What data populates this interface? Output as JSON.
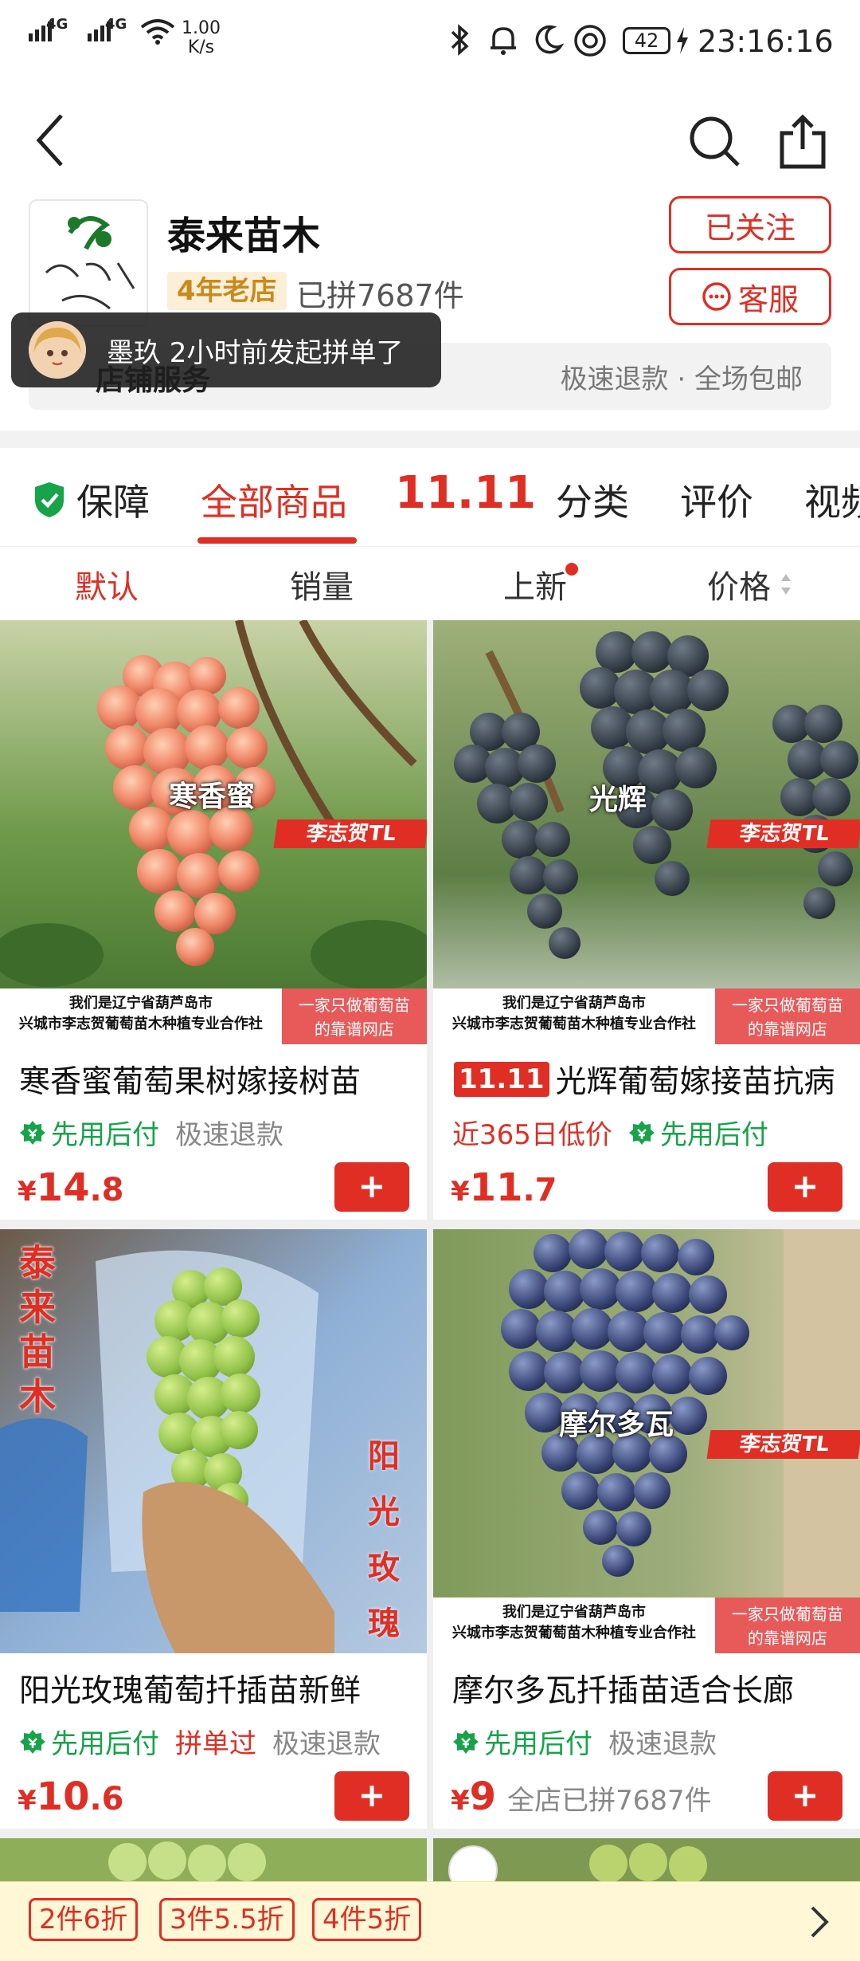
{
  "status_bar": {
    "network1": "4G",
    "network2": "4G",
    "speed_value": "1.00",
    "speed_unit": "K/s",
    "battery": "42",
    "time": "23:16:16"
  },
  "shop": {
    "name": "泰来苗木",
    "badge": "4年老店",
    "sold": "已拼7687件",
    "follow_label": "已关注",
    "service_label": "客服",
    "service_section_label": "店铺服务",
    "service_features": "极速退款 · 全场包邮"
  },
  "toast": {
    "text": "墨玖 2小时前发起拼单了"
  },
  "tabs": [
    {
      "label": "保障"
    },
    {
      "label": "全部商品"
    },
    {
      "label": "11.11"
    },
    {
      "label": "分类"
    },
    {
      "label": "评价"
    },
    {
      "label": "视频"
    }
  ],
  "sorts": [
    {
      "label": "默认"
    },
    {
      "label": "销量"
    },
    {
      "label": "上新"
    },
    {
      "label": "价格"
    }
  ],
  "products": [
    {
      "title": "寒香蜜葡萄果树嫁接树苗",
      "variety": "寒香蜜",
      "watermark": "李志贺TL",
      "banner_left": "我们是辽宁省葫芦岛市\n兴城市李志贺葡萄苗木种植专业合作社",
      "banner_right": "一家只做葡萄苗\n的靠谱网店",
      "tags": [
        "先用后付",
        "极速退款"
      ],
      "price_symbol": "¥",
      "price_int": "14",
      "price_dec": ".8"
    },
    {
      "title": "光辉葡萄嫁接苗抗病",
      "title_badge": "11.11",
      "variety": "光辉",
      "watermark": "李志贺TL",
      "banner_left": "我们是辽宁省葫芦岛市\n兴城市李志贺葡萄苗木种植专业合作社",
      "banner_right": "一家只做葡萄苗\n的靠谱网店",
      "tags": [
        "近365日低价",
        "先用后付"
      ],
      "price_symbol": "¥",
      "price_int": "11",
      "price_dec": ".7"
    },
    {
      "title": "阳光玫瑰葡萄扦插苗新鲜",
      "left_vertical": "泰来苗木",
      "right_vertical": "阳光玫瑰",
      "tags": [
        "先用后付",
        "拼单过",
        "极速退款"
      ],
      "price_symbol": "¥",
      "price_int": "10",
      "price_dec": ".6"
    },
    {
      "title": "摩尔多瓦扦插苗适合长廊",
      "variety": "摩尔多瓦",
      "watermark": "李志贺TL",
      "banner_left": "我们是辽宁省葫芦岛市\n兴城市李志贺葡萄苗木种植专业合作社",
      "banner_right": "一家只做葡萄苗\n的靠谱网店",
      "tags": [
        "先用后付",
        "极速退款"
      ],
      "price_symbol": "¥",
      "price_int": "9",
      "price_dec": "",
      "price_note": "全店已拼7687件"
    }
  ],
  "discounts": [
    "2件6折",
    "3件5.5折",
    "4件5折"
  ],
  "colors": {
    "accent": "#e02e24",
    "green": "#16a34a"
  }
}
